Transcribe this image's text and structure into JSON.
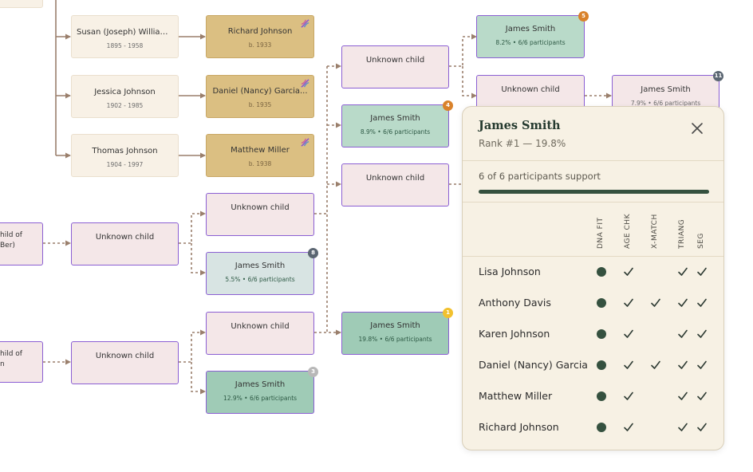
{
  "tree": {
    "persons": [
      {
        "name": "Susan (Joseph) Williams...",
        "years": "1895 - 1958"
      },
      {
        "name": "Jessica Johnson",
        "years": "1902 - 1985"
      },
      {
        "name": "Thomas Johnson",
        "years": "1904 - 1997"
      }
    ],
    "dna_matches": [
      {
        "name": "Richard Johnson",
        "birth": "b. 1933"
      },
      {
        "name": "Daniel (Nancy) Garcia...",
        "birth": "b. 1935"
      },
      {
        "name": "Matthew Miller",
        "birth": "b. 1938"
      }
    ],
    "partial_nodes": [
      "hild of\nBer)",
      "hild of\nn"
    ],
    "unknown_label": "Unknown child",
    "candidates": [
      {
        "name": "James Smith",
        "stat": "8.2% • 6/6 participants",
        "badge": "5"
      },
      {
        "name": "James Smith",
        "stat": "7.9% • 6/6 participants",
        "badge": "11"
      },
      {
        "name": "James Smith",
        "stat": "8.9% • 6/6 participants",
        "badge": "4"
      },
      {
        "name": "James Smith",
        "stat": "5.5% • 6/6 participants",
        "badge": "8"
      },
      {
        "name": "James Smith",
        "stat": "19.8% • 6/6 participants",
        "badge": "1"
      },
      {
        "name": "James Smith",
        "stat": "12.9% • 6/6 participants",
        "badge": "3"
      }
    ],
    "colors": {
      "line": "#9a7f6c",
      "highlight": "#8b5fd3"
    }
  },
  "popup": {
    "title": "James Smith",
    "rank": "Rank #1 — 19.8%",
    "support_text": "6 of 6 participants support",
    "support_fraction": 1.0,
    "columns": [
      "DNA FIT",
      "AGE CHK",
      "X-MATCH",
      "TRIANG",
      "SEG"
    ],
    "rows": [
      {
        "name": "Lisa Johnson",
        "dna_fit": true,
        "age_chk": true,
        "x_match": false,
        "triang": true,
        "seg": true
      },
      {
        "name": "Anthony Davis",
        "dna_fit": true,
        "age_chk": true,
        "x_match": true,
        "triang": true,
        "seg": true
      },
      {
        "name": "Karen Johnson",
        "dna_fit": true,
        "age_chk": true,
        "x_match": false,
        "triang": true,
        "seg": true
      },
      {
        "name": "Daniel (Nancy) Garcia",
        "dna_fit": true,
        "age_chk": true,
        "x_match": true,
        "triang": true,
        "seg": true
      },
      {
        "name": "Matthew Miller",
        "dna_fit": true,
        "age_chk": true,
        "x_match": false,
        "triang": true,
        "seg": true
      },
      {
        "name": "Richard Johnson",
        "dna_fit": true,
        "age_chk": true,
        "x_match": false,
        "triang": true,
        "seg": true
      }
    ]
  }
}
